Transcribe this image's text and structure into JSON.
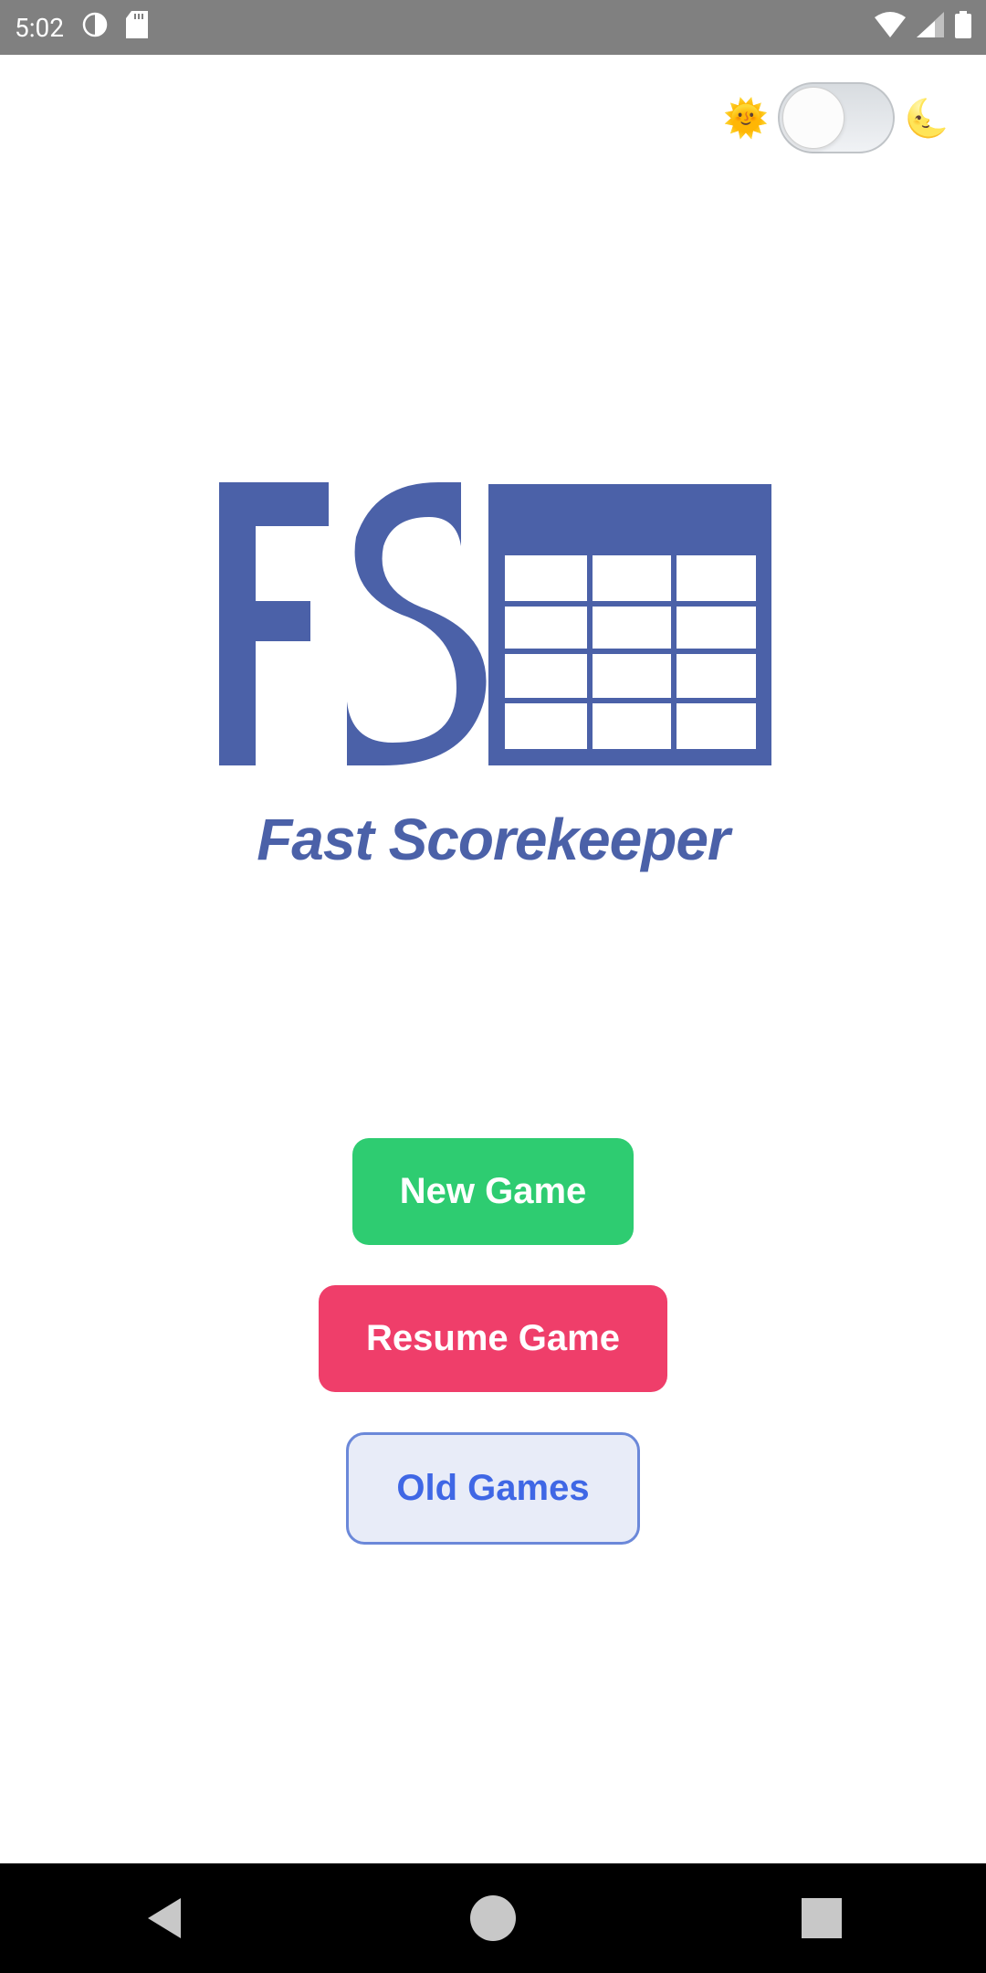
{
  "status_bar": {
    "time": "5:02"
  },
  "app": {
    "tagline": "Fast Scorekeeper"
  },
  "buttons": {
    "new_game": "New Game",
    "resume_game": "Resume Game",
    "old_games": "Old Games"
  },
  "theme": {
    "mode": "light"
  }
}
